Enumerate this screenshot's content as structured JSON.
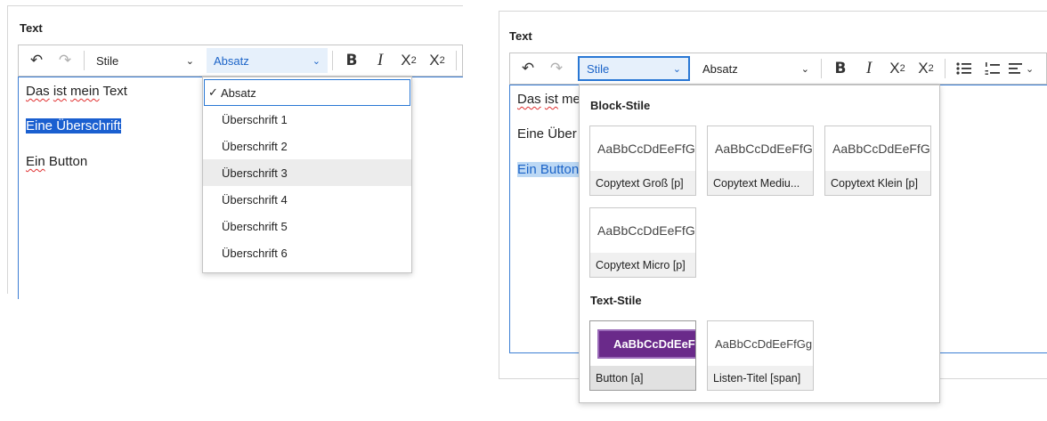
{
  "left": {
    "field_label": "Text",
    "toolbar": {
      "undo": "↶",
      "redo": "↷",
      "styles_label": "Stile",
      "format_label": "Absatz",
      "bold": "B",
      "italic": "I",
      "subscript_main": "X",
      "subscript_mark": "2",
      "superscript_main": "X",
      "superscript_mark": "2"
    },
    "editor_lines": {
      "line1_a": "Das",
      "line1_b": " ",
      "line1_c": "ist",
      "line1_d": " ",
      "line1_e": "mein",
      "line1_f": " Text",
      "line2": "Eine Überschrift",
      "line3_a": "Ein",
      "line3_b": " Button"
    },
    "format_menu": {
      "items": [
        "Absatz",
        "Überschrift 1",
        "Überschrift 2",
        "Überschrift 3",
        "Überschrift 4",
        "Überschrift 5",
        "Überschrift 6"
      ],
      "checkmark": "✓"
    }
  },
  "right": {
    "field_label": "Text",
    "toolbar": {
      "undo": "↶",
      "redo": "↷",
      "styles_label": "Stile",
      "format_label": "Absatz",
      "bold": "B",
      "italic": "I",
      "subscript_main": "X",
      "subscript_mark": "2",
      "superscript_main": "X",
      "superscript_mark": "2"
    },
    "editor_lines": {
      "line1_a": "Das",
      "line1_b": " ",
      "line1_c": "ist",
      "line1_d": " me",
      "line2": "Eine Über",
      "line3": "Ein Button"
    },
    "styles_menu": {
      "block_heading": "Block-Stile",
      "text_heading": "Text-Stile",
      "block_tiles": [
        {
          "preview": "AaBbCcDdEeFfGg",
          "caption": "Copytext Groß [p]"
        },
        {
          "preview": "AaBbCcDdEeFfGg",
          "caption": "Copytext Mediu..."
        },
        {
          "preview": "AaBbCcDdEeFfGg",
          "caption": "Copytext Klein [p]"
        },
        {
          "preview": "AaBbCcDdEeFfGg",
          "caption": "Copytext Micro [p]"
        }
      ],
      "text_tiles": [
        {
          "preview": "AaBbCcDdEeFfGg",
          "caption": "Button [a]"
        },
        {
          "preview": "AaBbCcDdEeFfGg",
          "caption": "Listen-Titel [span]"
        }
      ]
    }
  },
  "colors": {
    "accent": "#2977d4",
    "selection": "#1a5fd0",
    "button_style": "#6a2a8a"
  },
  "icons": {
    "undo": "undo-icon",
    "redo": "redo-icon",
    "chevron": "chevron-down-icon",
    "bullet_list": "bulleted-list-icon",
    "numbered_list": "numbered-list-icon",
    "align": "align-left-icon"
  }
}
